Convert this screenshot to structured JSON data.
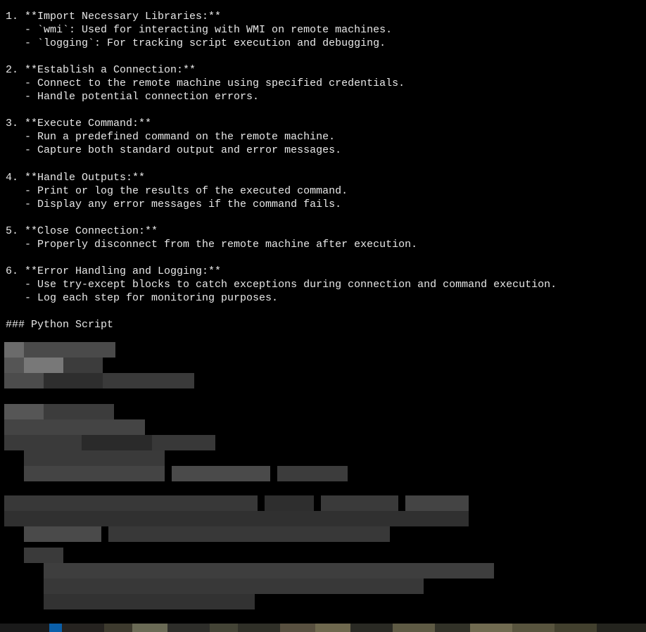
{
  "items": [
    {
      "num": "1.",
      "title": "**Import Necessary Libraries:**",
      "bullets": [
        "- `wmi`: Used for interacting with WMI on remote machines.",
        "- `logging`: For tracking script execution and debugging."
      ]
    },
    {
      "num": "2.",
      "title": "**Establish a Connection:**",
      "bullets": [
        "- Connect to the remote machine using specified credentials.",
        "- Handle potential connection errors."
      ]
    },
    {
      "num": "3.",
      "title": "**Execute Command:**",
      "bullets": [
        "- Run a predefined command on the remote machine.",
        "- Capture both standard output and error messages."
      ]
    },
    {
      "num": "4.",
      "title": "**Handle Outputs:**",
      "bullets": [
        "- Print or log the results of the executed command.",
        "- Display any error messages if the command fails."
      ]
    },
    {
      "num": "5.",
      "title": "**Close Connection:**",
      "bullets": [
        "- Properly disconnect from the remote machine after execution."
      ]
    },
    {
      "num": "6.",
      "title": "**Error Handling and Logging:**",
      "bullets": [
        "- Use try-except blocks to catch exceptions during connection and command execution.",
        "- Log each step for monitoring purposes."
      ]
    }
  ],
  "section_heading": "### Python Script"
}
